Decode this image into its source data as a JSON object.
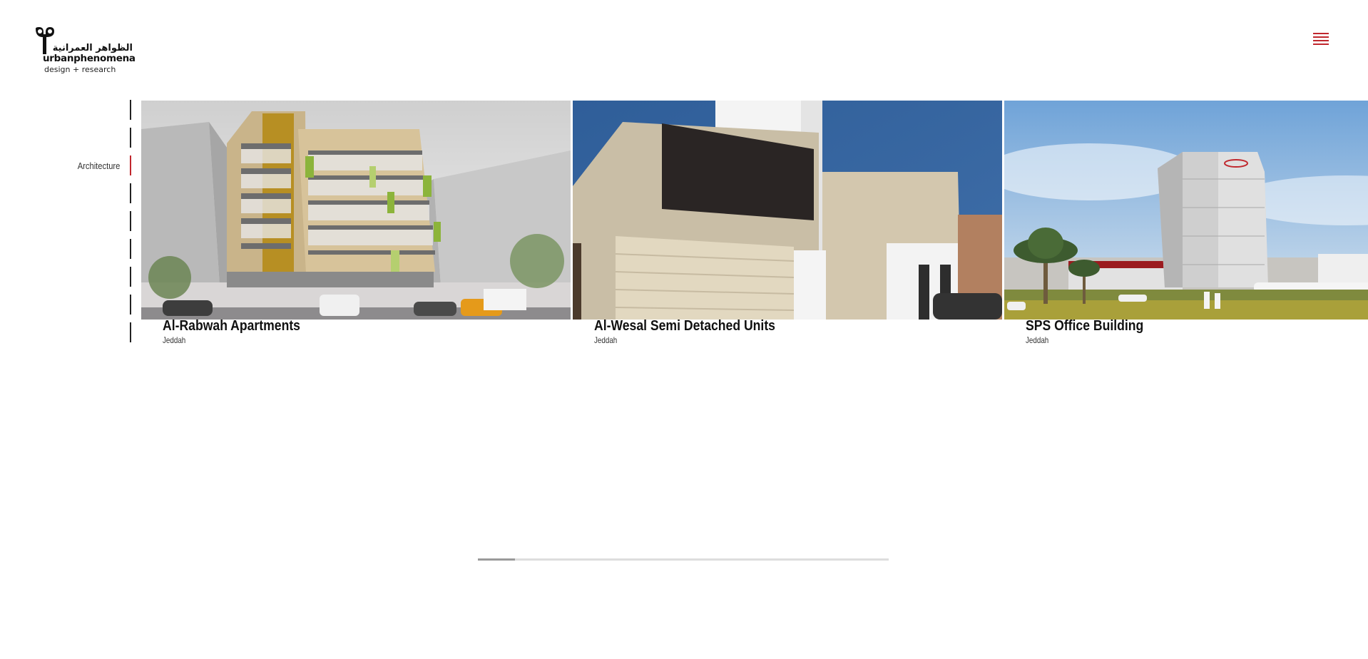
{
  "brand": {
    "arabic_name": "الظواهر العمرانية",
    "latin_name_part1": "urban",
    "latin_name_part2": "phenomena",
    "tagline": "design + research",
    "logo_icon": "up-monogram-icon"
  },
  "header": {
    "menu_icon": "hamburger-menu-icon",
    "accent_color": "#c0272d"
  },
  "category_nav": {
    "items": [
      {
        "label": "",
        "active": false
      },
      {
        "label": "",
        "active": false
      },
      {
        "label": "Architecture",
        "active": true
      },
      {
        "label": "",
        "active": false
      },
      {
        "label": "",
        "active": false
      },
      {
        "label": "",
        "active": false
      },
      {
        "label": "",
        "active": false
      },
      {
        "label": "",
        "active": false
      },
      {
        "label": "",
        "active": false
      }
    ]
  },
  "projects": [
    {
      "title": "Al-Rabwah Apartments",
      "location": "Jeddah"
    },
    {
      "title": "Al-Wesal Semi Detached Units",
      "location": "Jeddah"
    },
    {
      "title": "SPS Office Building",
      "location": "Jeddah"
    }
  ],
  "scroll": {
    "progress": 0.09
  }
}
